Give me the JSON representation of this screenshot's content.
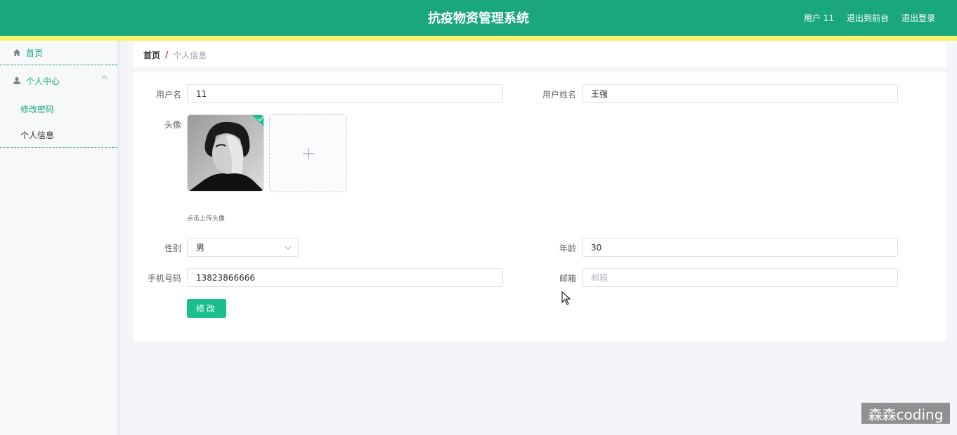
{
  "header": {
    "title": "抗疫物资管理系统",
    "user_label": "用户 11",
    "front_link": "退出到前台",
    "logout_link": "退出登录"
  },
  "sidebar": {
    "home": "首页",
    "group": "个人中心",
    "items": [
      "修改密码",
      "个人信息"
    ]
  },
  "breadcrumb": {
    "home": "首页",
    "separator": "/",
    "current": "个人信息"
  },
  "form": {
    "username_label": "用户名",
    "username_value": "11",
    "realname_label": "用户姓名",
    "realname_value": "王强",
    "avatar_label": "头像",
    "upload_hint": "点击上传头像",
    "gender_label": "性别",
    "gender_value": "男",
    "age_label": "年龄",
    "age_value": "30",
    "phone_label": "手机号码",
    "phone_value": "13823866666",
    "email_label": "邮箱",
    "email_placeholder": "邮箱",
    "submit_label": "修改"
  },
  "watermark": "森森coding",
  "colors": {
    "primary": "#1aa77d",
    "accent_strip": "#f8f46a",
    "button": "#19c08d"
  }
}
